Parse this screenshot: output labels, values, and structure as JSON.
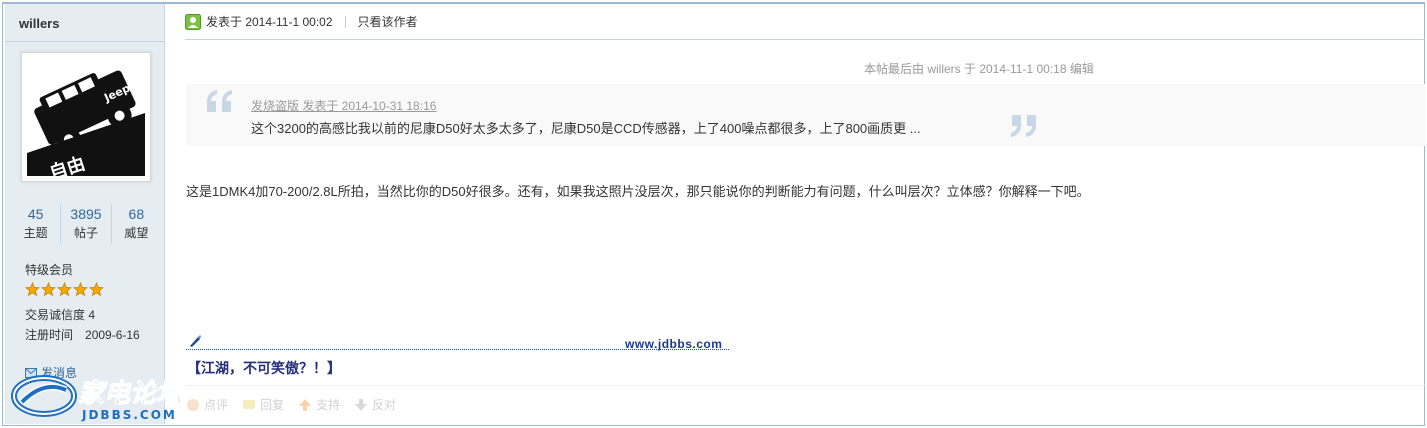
{
  "sidebar": {
    "username": "willers",
    "stats": [
      {
        "value": "45",
        "label": "主题"
      },
      {
        "value": "3895",
        "label": "帖子"
      },
      {
        "value": "68",
        "label": "威望"
      }
    ],
    "rank": "特级会员",
    "star_count": 5,
    "star_color": "#f5a800",
    "credit": "交易诚信度 4",
    "reg_label": "注册时间",
    "reg_date": "2009-6-16",
    "message_label": "发消息"
  },
  "post": {
    "time": "发表于 2014-11-1 00:02",
    "only_author": "只看该作者",
    "edit_note": "本帖最后由 willers 于 2014-11-1 00:18 编辑",
    "quote": {
      "author_line": "发烧盗版 发表于 2014-10-31 18:16",
      "text": "这个3200的高感比我以前的尼康D50好太多太多了，尼康D50是CCD传感器，上了400噪点都很多，上了800画质更 ..."
    },
    "body": "这是1DMK4加70-200/2.8L所拍，当然比你的D50好很多。还有，如果我这照片没层次，那只能说你的判断能力有问题，什么叫层次？立体感？你解释一下吧。",
    "signature": {
      "url": "www.jdbbs.com",
      "motto": "【江湖，不可笑傲？！】"
    },
    "actions": [
      "点评",
      "回复",
      "支持",
      "反对"
    ]
  },
  "watermark": {
    "title": "家电论坛",
    "domain": "JDBBS.COM"
  },
  "colors": {
    "sidebar_bg": "#e5edf2",
    "border": "#c2d5e3",
    "link": "#336699",
    "signature": "#27307a"
  }
}
